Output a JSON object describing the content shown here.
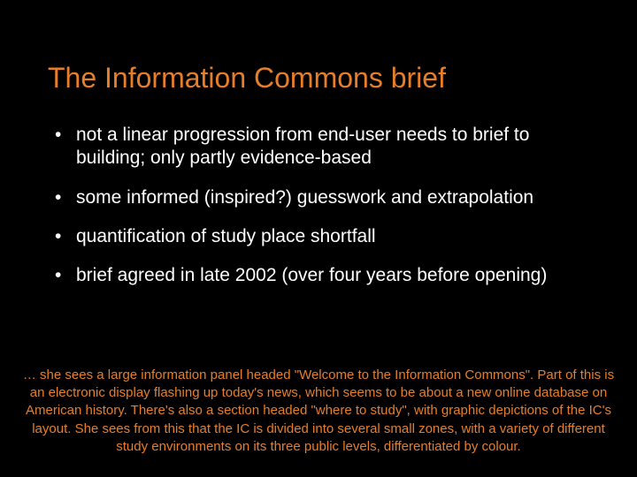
{
  "title": "The Information Commons brief",
  "bullets": [
    "not a linear progression from end-user needs to brief to building; only partly evidence-based",
    "some informed (inspired?) guesswork and extrapolation",
    "quantification of study place shortfall",
    "brief agreed in late 2002 (over four years before opening)"
  ],
  "footer": "… she sees a large information panel headed \"Welcome to the Information Commons\". Part of this is an electronic display flashing up today's news, which seems to be about a new online database on American history.  There's also a section headed \"where to study\", with graphic depictions of the IC's layout.  She sees from this that the IC is divided into several small zones, with a variety of different study environments on its three public levels, differentiated by colour."
}
